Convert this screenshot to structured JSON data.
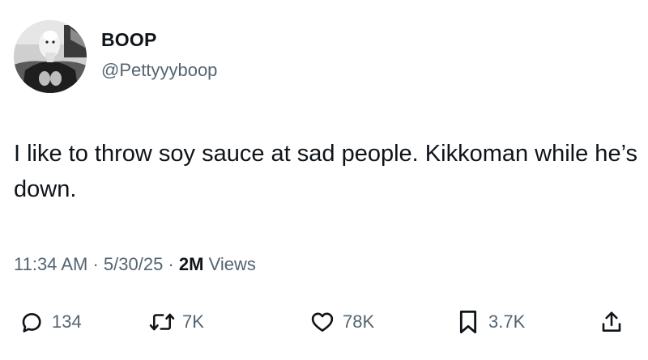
{
  "user": {
    "display_name": "BOOP",
    "handle": "@Pettyyyboop"
  },
  "tweet": {
    "text": "I like to throw soy sauce at sad people. Kikkoman while he’s down.",
    "time": "11:34 AM",
    "date": "5/30/25",
    "separator": "·",
    "views_count": "2M",
    "views_label": "Views"
  },
  "actions": {
    "replies": {
      "count": "134",
      "icon": "reply-icon"
    },
    "retweets": {
      "count": "7K",
      "icon": "retweet-icon"
    },
    "likes": {
      "count": "78K",
      "icon": "heart-icon"
    },
    "bookmarks": {
      "count": "3.7K",
      "icon": "bookmark-icon"
    },
    "share": {
      "icon": "share-icon"
    }
  },
  "colors": {
    "text_primary": "#0f1419",
    "text_secondary": "#536471",
    "background": "#ffffff"
  }
}
